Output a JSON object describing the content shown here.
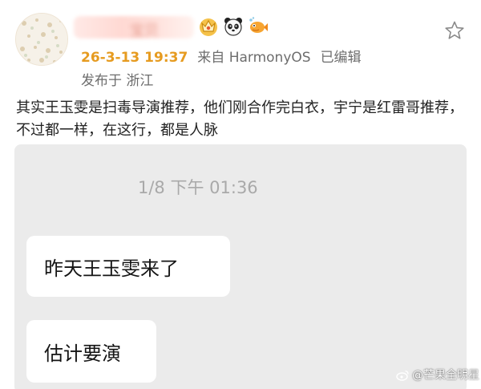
{
  "post": {
    "username": "宝贝",
    "badges": [
      "crown-badge",
      "panda-badge",
      "fish-badge"
    ],
    "time": "26-3-13 19:37",
    "source": "来自 HarmonyOS",
    "edited": "已编辑",
    "location": "发布于 浙江",
    "text": "其实王玉雯是扫毒导演推荐，他们刚合作完白衣，宇宁是红雷哥推荐，不过都一样，在这行，都是人脉"
  },
  "chat": {
    "timestamp": "1/8 下午 01:36",
    "messages": [
      "昨天王玉雯来了",
      "估计要演"
    ]
  },
  "watermark": "@芒果全明星",
  "colors": {
    "time": "#e69b20",
    "meta": "#6d6d6d",
    "chat_bg": "#ebebeb",
    "bubble_bg": "#ffffff"
  }
}
